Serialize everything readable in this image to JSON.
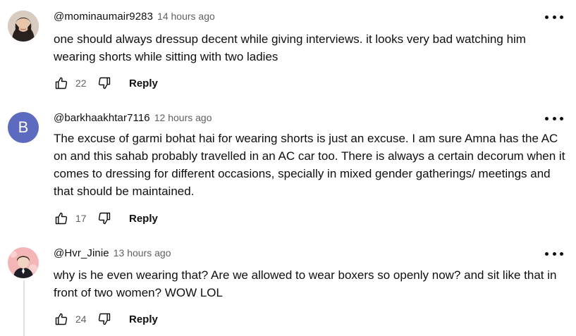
{
  "comments": [
    {
      "author": "@mominaumair9283",
      "time": "14 hours ago",
      "text": "one should always dressup decent while giving interviews. it looks very bad watching him wearing shorts while sitting with two ladies",
      "likes": "22",
      "reply_label": "Reply",
      "avatar_type": "photo"
    },
    {
      "author": "@barkhaakhtar7116",
      "time": "12 hours ago",
      "text": "The excuse of garmi bohat hai for wearing shorts is just an excuse. I am sure Amna has the AC on and this sahab probably travelled in an AC car too. There is always a certain decorum when it comes to dressing for different occasions, specially in mixed gender gatherings/ meetings and that should be maintained.",
      "likes": "17",
      "reply_label": "Reply",
      "avatar_letter": "B",
      "avatar_color": "#5c6bc0"
    },
    {
      "author": "@Hvr_Jinie",
      "time": "13 hours ago",
      "text": "why is he even wearing that? Are we allowed to wear boxers so openly now? and sit like that in front of two women? WOW LOL",
      "likes": "24",
      "reply_label": "Reply",
      "avatar_type": "photo"
    }
  ],
  "icons": {
    "like": "thumbs-up-icon",
    "dislike": "thumbs-down-icon",
    "more": "more-options-icon"
  }
}
